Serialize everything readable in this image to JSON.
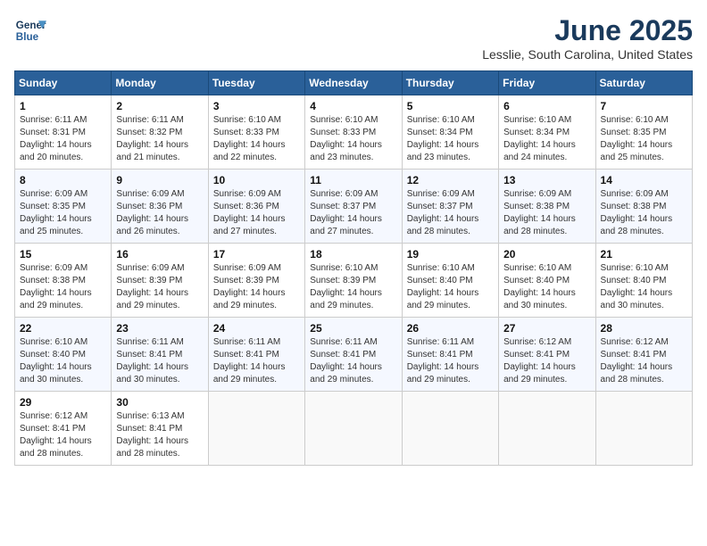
{
  "header": {
    "logo_line1": "General",
    "logo_line2": "Blue",
    "month": "June 2025",
    "location": "Lesslie, South Carolina, United States"
  },
  "weekdays": [
    "Sunday",
    "Monday",
    "Tuesday",
    "Wednesday",
    "Thursday",
    "Friday",
    "Saturday"
  ],
  "weeks": [
    [
      {
        "day": "1",
        "sunrise": "6:11 AM",
        "sunset": "8:31 PM",
        "daylight": "14 hours and 20 minutes."
      },
      {
        "day": "2",
        "sunrise": "6:11 AM",
        "sunset": "8:32 PM",
        "daylight": "14 hours and 21 minutes."
      },
      {
        "day": "3",
        "sunrise": "6:10 AM",
        "sunset": "8:33 PM",
        "daylight": "14 hours and 22 minutes."
      },
      {
        "day": "4",
        "sunrise": "6:10 AM",
        "sunset": "8:33 PM",
        "daylight": "14 hours and 23 minutes."
      },
      {
        "day": "5",
        "sunrise": "6:10 AM",
        "sunset": "8:34 PM",
        "daylight": "14 hours and 23 minutes."
      },
      {
        "day": "6",
        "sunrise": "6:10 AM",
        "sunset": "8:34 PM",
        "daylight": "14 hours and 24 minutes."
      },
      {
        "day": "7",
        "sunrise": "6:10 AM",
        "sunset": "8:35 PM",
        "daylight": "14 hours and 25 minutes."
      }
    ],
    [
      {
        "day": "8",
        "sunrise": "6:09 AM",
        "sunset": "8:35 PM",
        "daylight": "14 hours and 25 minutes."
      },
      {
        "day": "9",
        "sunrise": "6:09 AM",
        "sunset": "8:36 PM",
        "daylight": "14 hours and 26 minutes."
      },
      {
        "day": "10",
        "sunrise": "6:09 AM",
        "sunset": "8:36 PM",
        "daylight": "14 hours and 27 minutes."
      },
      {
        "day": "11",
        "sunrise": "6:09 AM",
        "sunset": "8:37 PM",
        "daylight": "14 hours and 27 minutes."
      },
      {
        "day": "12",
        "sunrise": "6:09 AM",
        "sunset": "8:37 PM",
        "daylight": "14 hours and 28 minutes."
      },
      {
        "day": "13",
        "sunrise": "6:09 AM",
        "sunset": "8:38 PM",
        "daylight": "14 hours and 28 minutes."
      },
      {
        "day": "14",
        "sunrise": "6:09 AM",
        "sunset": "8:38 PM",
        "daylight": "14 hours and 28 minutes."
      }
    ],
    [
      {
        "day": "15",
        "sunrise": "6:09 AM",
        "sunset": "8:38 PM",
        "daylight": "14 hours and 29 minutes."
      },
      {
        "day": "16",
        "sunrise": "6:09 AM",
        "sunset": "8:39 PM",
        "daylight": "14 hours and 29 minutes."
      },
      {
        "day": "17",
        "sunrise": "6:09 AM",
        "sunset": "8:39 PM",
        "daylight": "14 hours and 29 minutes."
      },
      {
        "day": "18",
        "sunrise": "6:10 AM",
        "sunset": "8:39 PM",
        "daylight": "14 hours and 29 minutes."
      },
      {
        "day": "19",
        "sunrise": "6:10 AM",
        "sunset": "8:40 PM",
        "daylight": "14 hours and 29 minutes."
      },
      {
        "day": "20",
        "sunrise": "6:10 AM",
        "sunset": "8:40 PM",
        "daylight": "14 hours and 30 minutes."
      },
      {
        "day": "21",
        "sunrise": "6:10 AM",
        "sunset": "8:40 PM",
        "daylight": "14 hours and 30 minutes."
      }
    ],
    [
      {
        "day": "22",
        "sunrise": "6:10 AM",
        "sunset": "8:40 PM",
        "daylight": "14 hours and 30 minutes."
      },
      {
        "day": "23",
        "sunrise": "6:11 AM",
        "sunset": "8:41 PM",
        "daylight": "14 hours and 30 minutes."
      },
      {
        "day": "24",
        "sunrise": "6:11 AM",
        "sunset": "8:41 PM",
        "daylight": "14 hours and 29 minutes."
      },
      {
        "day": "25",
        "sunrise": "6:11 AM",
        "sunset": "8:41 PM",
        "daylight": "14 hours and 29 minutes."
      },
      {
        "day": "26",
        "sunrise": "6:11 AM",
        "sunset": "8:41 PM",
        "daylight": "14 hours and 29 minutes."
      },
      {
        "day": "27",
        "sunrise": "6:12 AM",
        "sunset": "8:41 PM",
        "daylight": "14 hours and 29 minutes."
      },
      {
        "day": "28",
        "sunrise": "6:12 AM",
        "sunset": "8:41 PM",
        "daylight": "14 hours and 28 minutes."
      }
    ],
    [
      {
        "day": "29",
        "sunrise": "6:12 AM",
        "sunset": "8:41 PM",
        "daylight": "14 hours and 28 minutes."
      },
      {
        "day": "30",
        "sunrise": "6:13 AM",
        "sunset": "8:41 PM",
        "daylight": "14 hours and 28 minutes."
      },
      null,
      null,
      null,
      null,
      null
    ]
  ]
}
